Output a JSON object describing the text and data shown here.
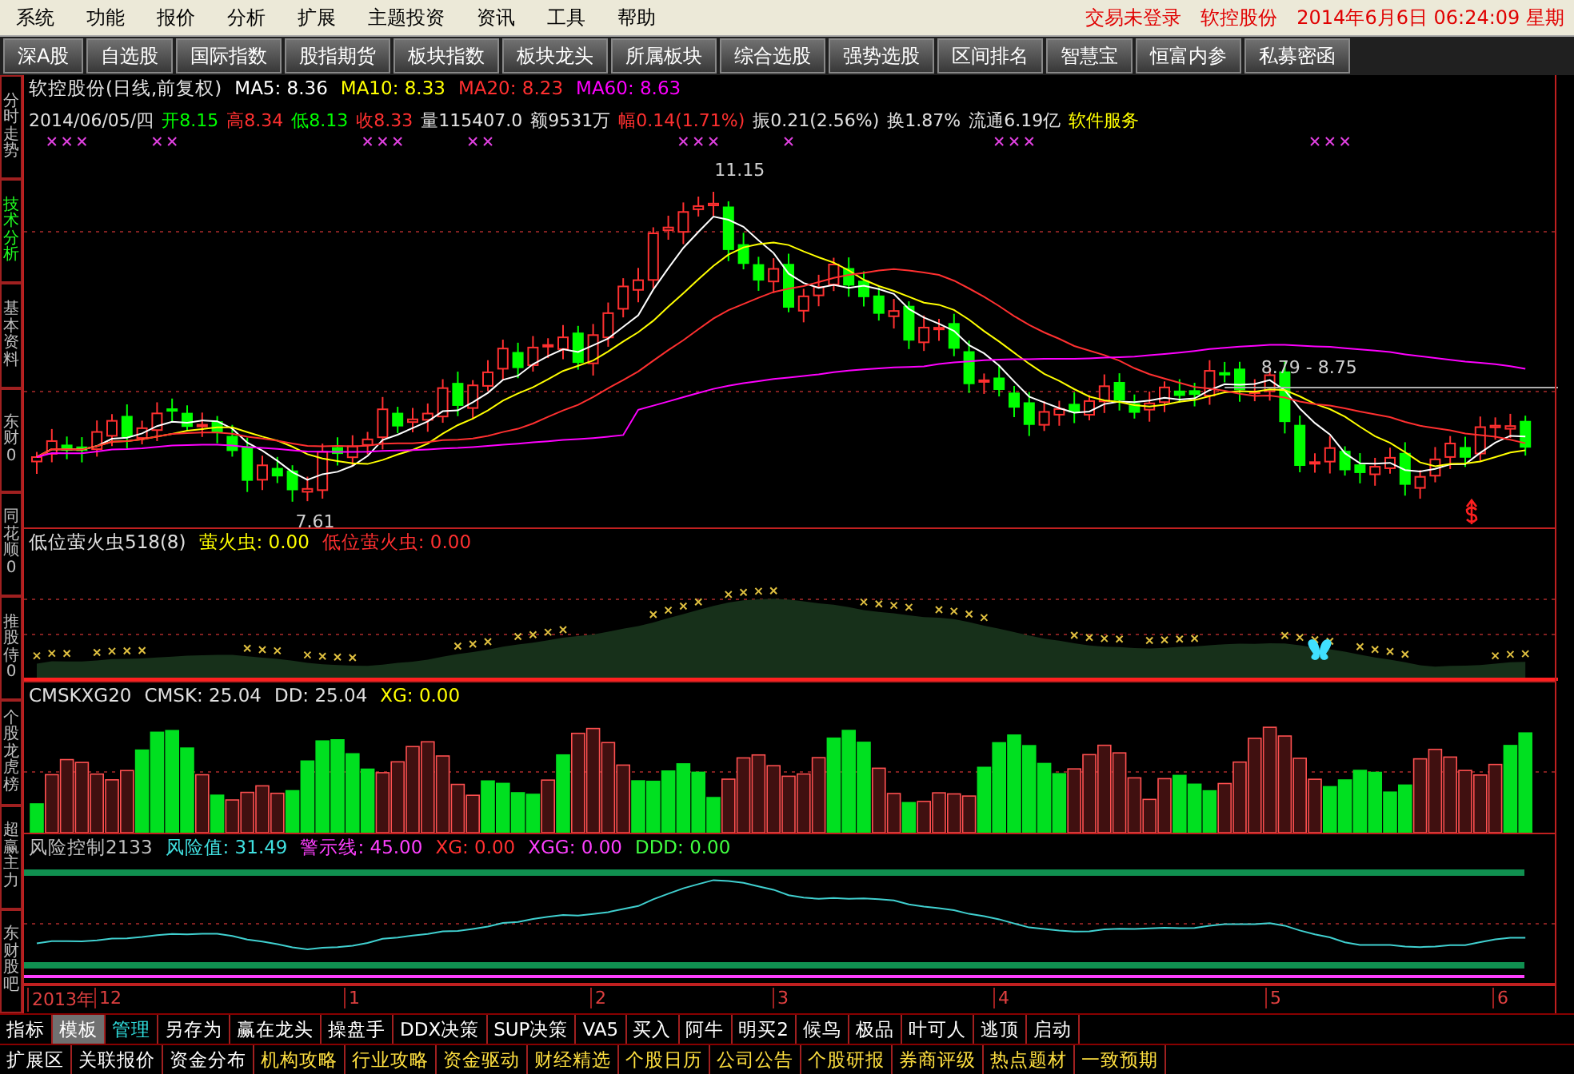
{
  "menu_bar": {
    "items": [
      "系统",
      "功能",
      "报价",
      "分析",
      "扩展",
      "主题投资",
      "资讯",
      "工具",
      "帮助"
    ],
    "status": [
      "交易未登录",
      "软控股份",
      "2014年6月6日 06:24:09 星期"
    ]
  },
  "toolbar": [
    "深A股",
    "自选股",
    "国际指数",
    "股指期货",
    "板块指数",
    "板块龙头",
    "所属板块",
    "综合选股",
    "强势选股",
    "区间排名",
    "智慧宝",
    "恒富内参",
    "私募密函"
  ],
  "side_tabs": [
    {
      "label": "分时走势",
      "selected": false
    },
    {
      "label": "技术分析",
      "selected": true
    },
    {
      "label": "基本资料",
      "selected": false
    },
    {
      "label": "东财0",
      "selected": false
    },
    {
      "label": "同花顺0",
      "selected": false
    },
    {
      "label": "推股侍0",
      "selected": false
    },
    {
      "label": "个股龙虎榜",
      "selected": false
    },
    {
      "label": "超赢主力",
      "selected": false
    },
    {
      "label": "东财股吧",
      "selected": false
    }
  ],
  "main_chart": {
    "indicators": [
      {
        "text": "软控股份(日线,前复权)",
        "color": "#e0e0e0"
      },
      {
        "text": "MA5: 8.36",
        "color": "#ffffff"
      },
      {
        "text": "MA10: 8.33",
        "color": "#ffff00"
      },
      {
        "text": "MA20: 8.23",
        "color": "#ff3030"
      },
      {
        "text": "MA60: 8.63",
        "color": "#ff00ff"
      }
    ],
    "quote": [
      {
        "text": "2014/06/05/四",
        "color": "#e0e0e0"
      },
      {
        "text": "开8.15",
        "color": "#00ff00"
      },
      {
        "text": "高8.34",
        "color": "#ff3030"
      },
      {
        "text": "低8.13",
        "color": "#00ff00"
      },
      {
        "text": "收8.33",
        "color": "#ff3030"
      },
      {
        "text": "量115407.0",
        "color": "#e0e0e0"
      },
      {
        "text": "额9531万",
        "color": "#e0e0e0"
      },
      {
        "text": "幅0.14(1.71%)",
        "color": "#ff3030"
      },
      {
        "text": "振0.21(2.56%)",
        "color": "#e0e0e0"
      },
      {
        "text": "换1.87%",
        "color": "#e0e0e0"
      },
      {
        "text": "流通6.19亿",
        "color": "#e0e0e0"
      },
      {
        "text": "软件服务",
        "color": "#ffff00"
      }
    ],
    "high_label": "11.15",
    "low_label": "7.61",
    "range_label": "8.79 - 8.75"
  },
  "firefly_panel": {
    "values": [
      {
        "text": "低位萤火虫518(8)",
        "color": "#e0e0e0"
      },
      {
        "text": "萤火虫: 0.00",
        "color": "#ffff00"
      },
      {
        "text": "低位萤火虫: 0.00",
        "color": "#ff3030"
      }
    ]
  },
  "cmsk_panel": {
    "values": [
      {
        "text": "CMSKXG20",
        "color": "#e0e0e0"
      },
      {
        "text": "CMSK: 25.04",
        "color": "#e0e0e0"
      },
      {
        "text": "DD: 25.04",
        "color": "#e0e0e0"
      },
      {
        "text": "XG: 0.00",
        "color": "#ffff00"
      }
    ]
  },
  "risk_panel": {
    "values": [
      {
        "text": "风险控制2133",
        "color": "#c0c0c0"
      },
      {
        "text": "风险值: 31.49",
        "color": "#40e0e0"
      },
      {
        "text": "警示线: 45.00",
        "color": "#ff40ff"
      },
      {
        "text": "XG: 0.00",
        "color": "#ff3030"
      },
      {
        "text": "XGG: 0.00",
        "color": "#ff40ff"
      },
      {
        "text": "DDD: 0.00",
        "color": "#40ff40"
      }
    ]
  },
  "date_axis": [
    "2013年",
    "12",
    "1",
    "2",
    "3",
    "4",
    "5",
    "6"
  ],
  "indicator_tabs": [
    {
      "label": "指标",
      "selected": false,
      "highlighted": false
    },
    {
      "label": "模板",
      "selected": true,
      "highlighted": false
    },
    {
      "label": "管理",
      "selected": false,
      "highlighted": true
    },
    {
      "label": "另存为",
      "selected": false,
      "highlighted": false
    },
    {
      "label": "赢在龙头",
      "selected": false,
      "highlighted": false
    },
    {
      "label": "操盘手",
      "selected": false,
      "highlighted": false
    },
    {
      "label": "DDX决策",
      "selected": false,
      "highlighted": false
    },
    {
      "label": "SUP决策",
      "selected": false,
      "highlighted": false
    },
    {
      "label": "VA5",
      "selected": false,
      "highlighted": false
    },
    {
      "label": "买入",
      "selected": false,
      "highlighted": false
    },
    {
      "label": "阿牛",
      "selected": false,
      "highlighted": false
    },
    {
      "label": "明买2",
      "selected": false,
      "highlighted": false
    },
    {
      "label": "候鸟",
      "selected": false,
      "highlighted": false
    },
    {
      "label": "极品",
      "selected": false,
      "highlighted": false
    },
    {
      "label": "叶可人",
      "selected": false,
      "highlighted": false
    },
    {
      "label": "逃顶",
      "selected": false,
      "highlighted": false
    },
    {
      "label": "启动",
      "selected": false,
      "highlighted": false
    }
  ],
  "info_tabs": [
    {
      "label": "扩展区",
      "kind": "base"
    },
    {
      "label": "关联报价",
      "kind": "base"
    },
    {
      "label": "资金分布",
      "kind": "base"
    },
    {
      "label": "机构攻略",
      "kind": "f10"
    },
    {
      "label": "行业攻略",
      "kind": "f10"
    },
    {
      "label": "资金驱动",
      "kind": "f10"
    },
    {
      "label": "财经精选",
      "kind": "f10"
    },
    {
      "label": "个股日历",
      "kind": "f10"
    },
    {
      "label": "公司公告",
      "kind": "f10"
    },
    {
      "label": "个股研报",
      "kind": "f10"
    },
    {
      "label": "券商评级",
      "kind": "f10"
    },
    {
      "label": "热点题材",
      "kind": "f10"
    },
    {
      "label": "一致预期",
      "kind": "f10"
    }
  ]
}
